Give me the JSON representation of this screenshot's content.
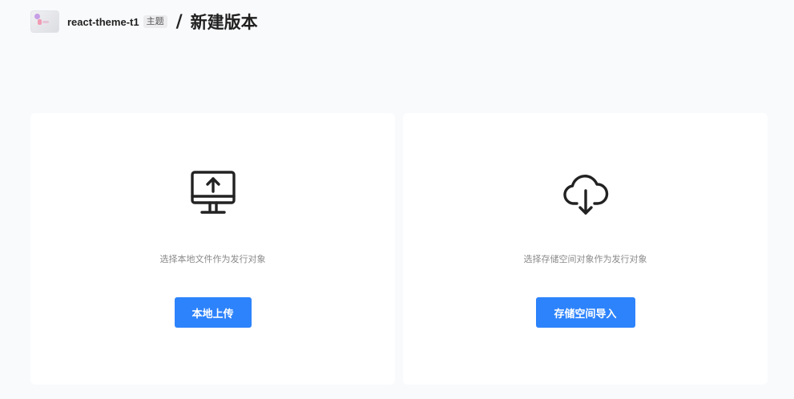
{
  "header": {
    "app_name": "react-theme-t1",
    "tag": "主题",
    "separator": "/",
    "title": "新建版本"
  },
  "cards": [
    {
      "icon": "monitor-upload-icon",
      "description": "选择本地文件作为发行对象",
      "button_label": "本地上传"
    },
    {
      "icon": "cloud-download-icon",
      "description": "选择存储空间对象作为发行对象",
      "button_label": "存储空间导入"
    }
  ],
  "colors": {
    "background": "#f9fafc",
    "card": "#ffffff",
    "primary": "#2d83fb",
    "description": "#8a8a8a"
  }
}
